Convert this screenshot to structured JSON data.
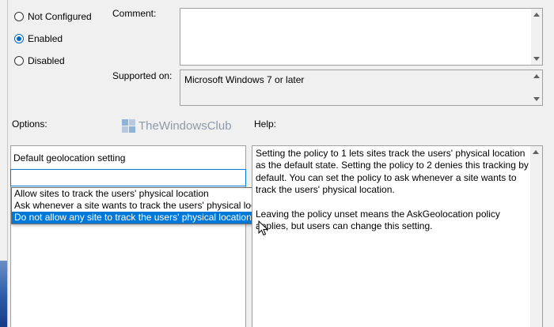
{
  "state": {
    "options": [
      {
        "label": "Not Configured",
        "checked": false
      },
      {
        "label": "Enabled",
        "checked": true
      },
      {
        "label": "Disabled",
        "checked": false
      }
    ]
  },
  "comment_label": "Comment:",
  "supported_on_label": "Supported on:",
  "supported_on_value": "Microsoft Windows 7 or later",
  "options_label": "Options:",
  "help_label": "Help:",
  "option_panel": {
    "setting_label": "Default geolocation setting",
    "dropdown_items": [
      {
        "label": "Allow sites to track the users' physical location",
        "selected": false
      },
      {
        "label": "Ask whenever a site wants to track the users' physical location",
        "selected": false
      },
      {
        "label": "Do not allow any site to track the users' physical location",
        "selected": true
      }
    ]
  },
  "help_text": {
    "p1_line1": "Setting the policy to 1 lets sites track the users' physical location",
    "p1_line2": "as the default state. Setting the policy to 2 denies this tracking by",
    "p1_line3": "default. You can set the policy to ask whenever a site wants to",
    "p1_line4": "track the users' physical location.",
    "p2_line1": "Leaving the policy unset means the AskGeolocation policy",
    "p2_line2": "applies, but users can change this setting."
  },
  "watermark": {
    "text": "TheWindowsClub"
  },
  "colors": {
    "accent": "#0078d7",
    "radio": "#0067c0"
  }
}
